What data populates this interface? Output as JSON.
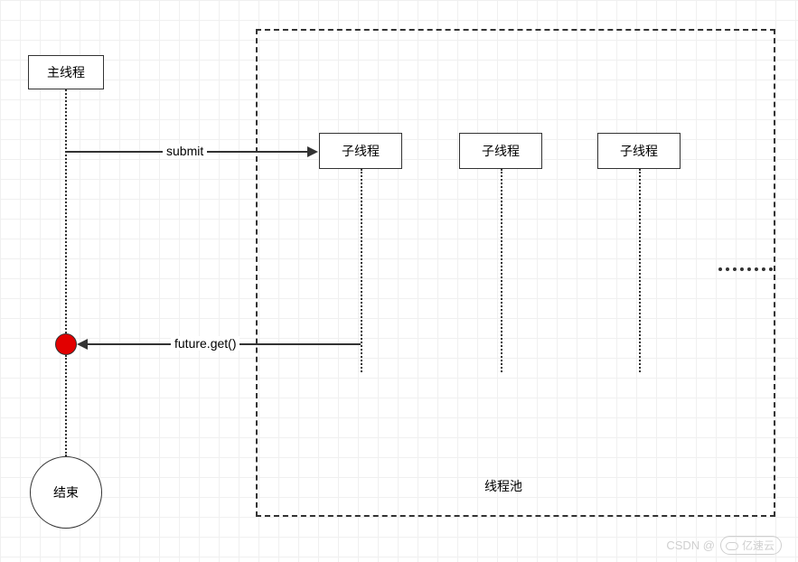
{
  "main_thread": {
    "label": "主线程"
  },
  "submit": {
    "label": "submit"
  },
  "future_get": {
    "label": "future.get()"
  },
  "end": {
    "label": "结束"
  },
  "thread_pool": {
    "label": "线程池",
    "children": [
      {
        "label": "子线程"
      },
      {
        "label": "子线程"
      },
      {
        "label": "子线程"
      }
    ]
  },
  "ellipsis": "……",
  "watermark": {
    "prefix": "CSDN @",
    "brand": "亿速云"
  }
}
